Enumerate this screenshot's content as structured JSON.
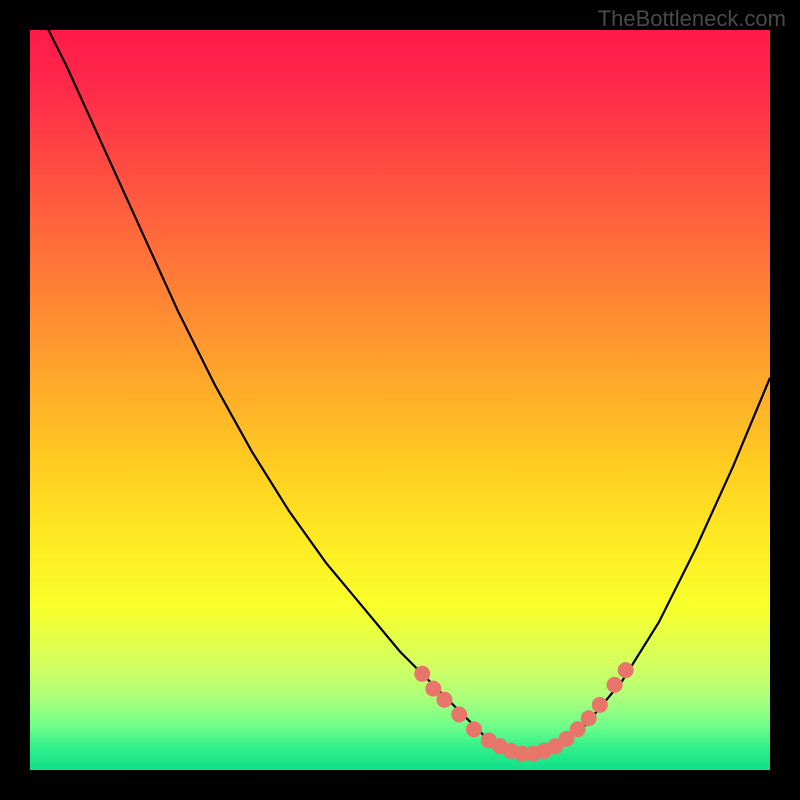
{
  "watermark": "TheBottleneck.com",
  "chart_data": {
    "type": "line",
    "title": "",
    "xlabel": "",
    "ylabel": "",
    "xlim": [
      0,
      100
    ],
    "ylim": [
      0,
      100
    ],
    "gradient_colors": {
      "top": "#ff1a4a",
      "mid_orange": "#ff8a32",
      "mid_yellow": "#ffe822",
      "bottom": "#10df8a"
    },
    "series": [
      {
        "name": "bottleneck-curve",
        "color": "#000000",
        "x": [
          0,
          5,
          10,
          15,
          20,
          25,
          30,
          35,
          40,
          45,
          50,
          55,
          60,
          62,
          64,
          66,
          68,
          70,
          72,
          75,
          80,
          85,
          90,
          95,
          100
        ],
        "y": [
          105,
          95,
          84,
          73,
          62,
          52,
          43,
          35,
          28,
          22,
          16,
          11,
          6,
          4,
          3,
          2,
          2,
          3,
          4,
          6,
          12,
          20,
          30,
          41,
          53
        ]
      }
    ],
    "scatter_points": {
      "name": "optimum-markers",
      "color": "#e8756a",
      "radius": 8,
      "points": [
        {
          "x": 53,
          "y": 13
        },
        {
          "x": 54.5,
          "y": 11
        },
        {
          "x": 56,
          "y": 9.5
        },
        {
          "x": 58,
          "y": 7.5
        },
        {
          "x": 60,
          "y": 5.5
        },
        {
          "x": 62,
          "y": 4
        },
        {
          "x": 63.5,
          "y": 3.2
        },
        {
          "x": 65,
          "y": 2.6
        },
        {
          "x": 66.5,
          "y": 2.2
        },
        {
          "x": 68,
          "y": 2.2
        },
        {
          "x": 69.5,
          "y": 2.6
        },
        {
          "x": 71,
          "y": 3.2
        },
        {
          "x": 72.5,
          "y": 4.2
        },
        {
          "x": 74,
          "y": 5.5
        },
        {
          "x": 75.5,
          "y": 7
        },
        {
          "x": 77,
          "y": 8.8
        },
        {
          "x": 79,
          "y": 11.5
        },
        {
          "x": 80.5,
          "y": 13.5
        }
      ]
    }
  }
}
